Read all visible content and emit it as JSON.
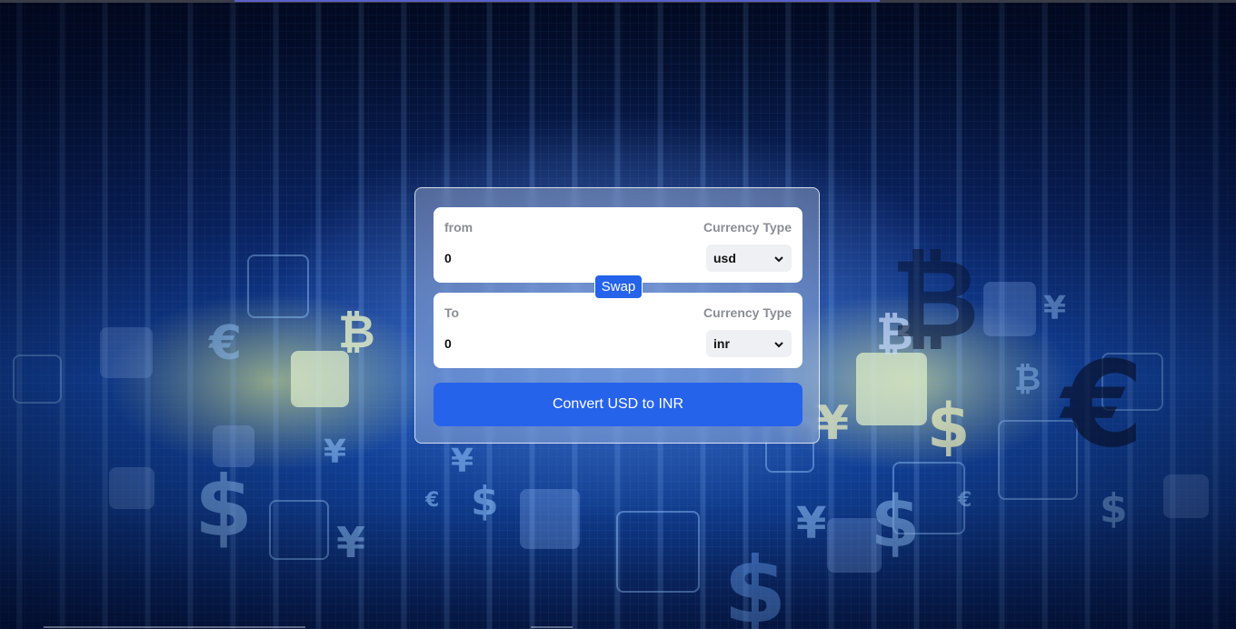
{
  "converter": {
    "from_panel": {
      "label": "from",
      "currency_type_label": "Currency Type",
      "amount_value": "0",
      "selected_currency": "usd"
    },
    "to_panel": {
      "label": "To",
      "currency_type_label": "Currency Type",
      "amount_value": "0",
      "selected_currency": "inr"
    },
    "swap_label": "Swap",
    "convert_label": "Convert USD to INR"
  },
  "colors": {
    "primary": "#2563eb",
    "label_gray": "#8a8d94",
    "panel_bg": "#ffffff"
  },
  "background": {
    "glyphs": [
      "€",
      "₿",
      "₿",
      "$",
      "¥",
      "¥",
      "$",
      "₿",
      "¥",
      "$",
      "€",
      "₿",
      "$",
      "¥",
      "€",
      "$",
      "¥",
      "$",
      "€",
      "¥"
    ]
  }
}
